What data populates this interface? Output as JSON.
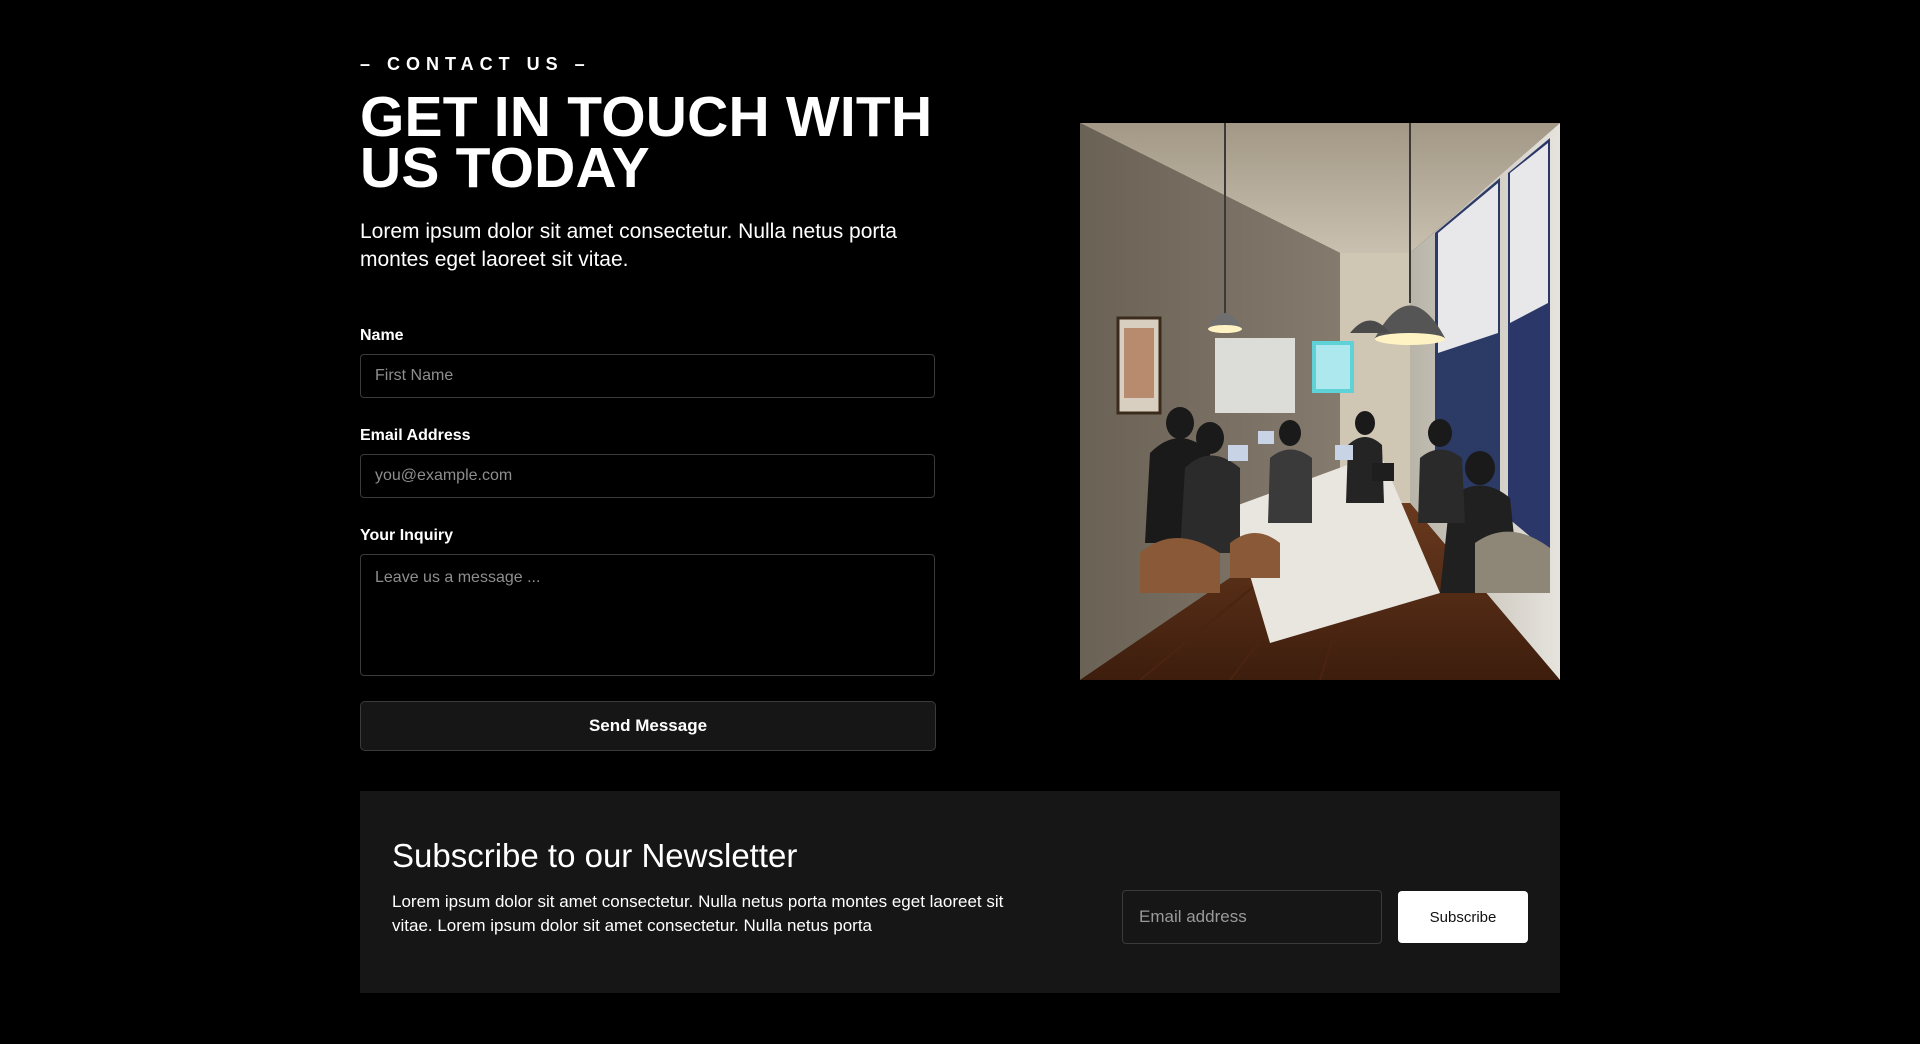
{
  "contact": {
    "eyebrow": "– CONTACT US –",
    "headline": "GET IN TOUCH WITH US TODAY",
    "intro": "Lorem ipsum dolor sit amet consectetur. Nulla netus porta montes eget laoreet sit vitae.",
    "form": {
      "name_label": "Name",
      "name_placeholder": "First Name",
      "email_label": "Email Address",
      "email_placeholder": "you@example.com",
      "inquiry_label": "Your Inquiry",
      "inquiry_placeholder": "Leave us a message ...",
      "submit_label": "Send Message"
    }
  },
  "newsletter": {
    "title": "Subscribe to our Newsletter",
    "text": "Lorem ipsum dolor sit amet consectetur. Nulla netus porta montes eget laoreet sit vitae. Lorem ipsum dolor sit amet consectetur. Nulla netus porta",
    "email_placeholder": "Email address",
    "button_label": "Subscribe"
  },
  "colors": {
    "background": "#000000",
    "panel": "#161616",
    "border": "#3a3a3a",
    "text": "#ffffff",
    "placeholder": "#8e8e8e"
  }
}
